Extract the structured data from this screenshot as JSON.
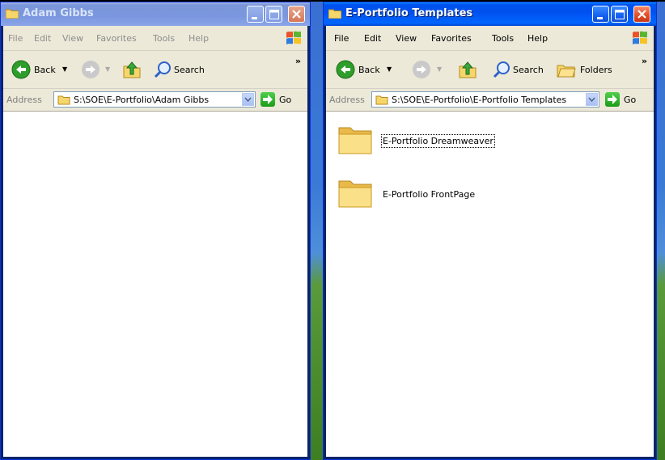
{
  "windows": [
    {
      "title": "Adam Gibbs",
      "active": false,
      "menu": [
        "File",
        "Edit",
        "View",
        "Favorites",
        "Tools",
        "Help"
      ],
      "toolbar": {
        "back": "Back",
        "search": "Search"
      },
      "address": {
        "label": "Address",
        "path": "S:\\SOE\\E-Portfolio\\Adam Gibbs",
        "go": "Go"
      },
      "items": []
    },
    {
      "title": "E-Portfolio Templates",
      "active": true,
      "menu": [
        "File",
        "Edit",
        "View",
        "Favorites",
        "Tools",
        "Help"
      ],
      "toolbar": {
        "back": "Back",
        "search": "Search",
        "folders": "Folders"
      },
      "address": {
        "label": "Address",
        "path": "S:\\SOE\\E-Portfolio\\E-Portfolio Templates",
        "go": "Go"
      },
      "items": [
        {
          "name": "E-Portfolio Dreamweaver",
          "type": "folder",
          "focused": true
        },
        {
          "name": "E-Portfolio FrontPage",
          "type": "folder",
          "focused": false
        }
      ]
    }
  ],
  "icons": {
    "folder": "folder-icon",
    "back": "back-arrow-icon",
    "forward": "forward-arrow-icon",
    "up": "up-folder-icon",
    "search": "search-magnifier-icon",
    "folders": "folders-icon",
    "go": "go-arrow-icon",
    "minimize": "minimize-icon",
    "maximize": "maximize-icon",
    "close": "close-icon",
    "windows_logo": "windows-logo-icon",
    "chevron": "toolbar-chevron-icon"
  },
  "colors": {
    "titlebar_active": "#0053ee",
    "titlebar_inactive": "#7a96df",
    "chrome": "#ece9d8",
    "content": "#ffffff",
    "close_button": "#e4502a"
  }
}
